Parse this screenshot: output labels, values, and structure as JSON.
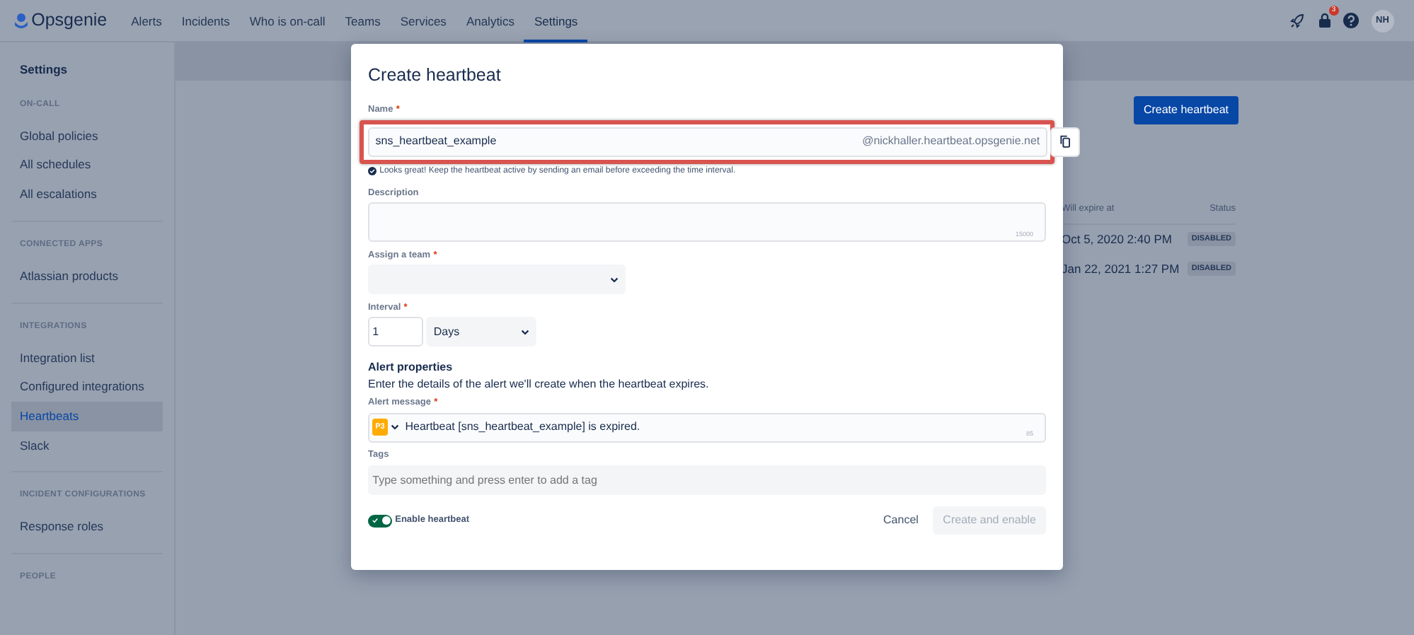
{
  "topnav": {
    "logo": "Opsgenie",
    "items": [
      {
        "label": "Alerts",
        "selected": false
      },
      {
        "label": "Incidents",
        "selected": false
      },
      {
        "label": "Who is on-call",
        "selected": false
      },
      {
        "label": "Teams",
        "selected": false
      },
      {
        "label": "Services",
        "selected": false
      },
      {
        "label": "Analytics",
        "selected": false
      },
      {
        "label": "Settings",
        "selected": true
      }
    ],
    "notification_count": "3",
    "avatar": "NH"
  },
  "sidebar": {
    "title": "Settings",
    "sections": [
      {
        "heading": "ON-CALL",
        "items": [
          {
            "label": "Global policies",
            "selected": false
          },
          {
            "label": "All schedules",
            "selected": false
          },
          {
            "label": "All escalations",
            "selected": false
          }
        ]
      },
      {
        "heading": "CONNECTED APPS",
        "items": [
          {
            "label": "Atlassian products",
            "selected": false
          }
        ]
      },
      {
        "heading": "INTEGRATIONS",
        "items": [
          {
            "label": "Integration list",
            "selected": false
          },
          {
            "label": "Configured integrations",
            "selected": false
          },
          {
            "label": "Heartbeats",
            "selected": true
          },
          {
            "label": "Slack",
            "selected": false
          }
        ]
      },
      {
        "heading": "INCIDENT CONFIGURATIONS",
        "items": [
          {
            "label": "Response roles",
            "selected": false
          }
        ]
      },
      {
        "heading": "PEOPLE"
      }
    ]
  },
  "page": {
    "create_button": "Create heartbeat",
    "table": {
      "columns": [
        "Will expire at",
        "Status"
      ],
      "rows": [
        {
          "expires": "Oct 5, 2020 2:40 PM",
          "status": "DISABLED"
        },
        {
          "expires": "Jan 22, 2021 1:27 PM",
          "status": "DISABLED"
        }
      ]
    }
  },
  "modal": {
    "title": "Create heartbeat",
    "name": {
      "label": "Name",
      "required_mark": "*",
      "value": "sns_heartbeat_example",
      "suffix": "@nickhaller.heartbeat.opsgenie.net",
      "hint": "Looks great! Keep the heartbeat active by sending an email before exceeding the time interval."
    },
    "description": {
      "label": "Description",
      "counter": "15000"
    },
    "team": {
      "label": "Assign a team",
      "required_mark": "*"
    },
    "interval": {
      "label": "Interval",
      "required_mark": "*",
      "value": "1",
      "unit": "Days"
    },
    "alert": {
      "heading": "Alert properties",
      "text": "Enter the details of the alert we'll create when the heartbeat expires.",
      "message_label": "Alert message",
      "required_mark": "*",
      "priority": "P3",
      "message": "Heartbeat [sns_heartbeat_example] is expired.",
      "counter": "85"
    },
    "tags": {
      "label": "Tags",
      "placeholder": "Type something and press enter to add a tag"
    },
    "enable": {
      "label": "Enable heartbeat",
      "on": true
    },
    "buttons": [
      {
        "label": "Cancel",
        "kind": "subtle",
        "disabled": false
      },
      {
        "label": "Create and enable",
        "kind": "primary",
        "disabled": true
      }
    ]
  }
}
